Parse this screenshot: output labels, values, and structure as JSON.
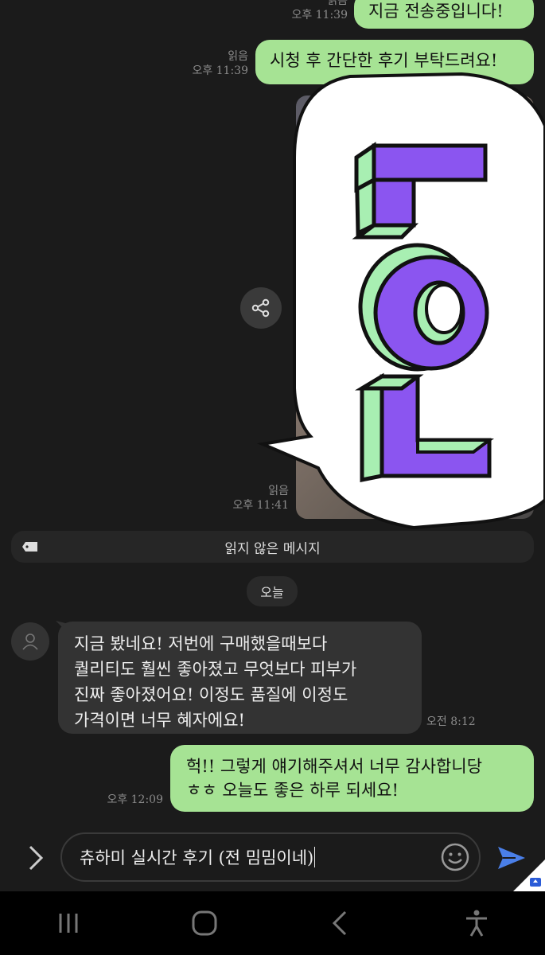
{
  "messages": {
    "msg1": {
      "text": "지금 전송중입니다!",
      "read": "읽음",
      "time": "오후 11:39"
    },
    "msg2": {
      "text": "시청 후 간단한 후기 부탁드려요!",
      "read": "읽음",
      "time": "오후 11:39"
    },
    "photo": {
      "read": "읽음",
      "time": "오후 11:41"
    },
    "incoming": {
      "lines": [
        "지금 봤네요! 저번에 구매했을때보다",
        "퀄리티도 훨씬 좋아졌고 무엇보다 피부가",
        "진짜 좋아졌어요! 이정도 품질에 이정도",
        "가격이면 너무 혜자에요!"
      ],
      "time": "오전 8:12"
    },
    "reply": {
      "lines": [
        "헉!! 그렇게 얘기해주셔서 너무 감사합니당",
        "ㅎㅎ 오늘도 좋은 하루 되세요!"
      ],
      "time": "오후 12:09"
    }
  },
  "unread_divider": "읽지 않은 메시지",
  "date_divider": "오늘",
  "sticker": {
    "text": "LOL",
    "colors": {
      "face": "#8b55f0",
      "side": "#a8efb2",
      "outline": "#111111",
      "bubble": "#ffffff"
    }
  },
  "composer": {
    "value": "츄하미 실시간 후기 (전 밈밈이네)"
  },
  "colors": {
    "outgoing": "#a6e394",
    "incoming": "#333333",
    "send": "#4a7fe8"
  },
  "icons": [
    "chevron-right-icon",
    "emoji-icon",
    "send-icon",
    "share-icon",
    "tag-icon",
    "person-icon",
    "recent-apps-icon",
    "home-icon",
    "back-icon",
    "accessibility-icon"
  ]
}
